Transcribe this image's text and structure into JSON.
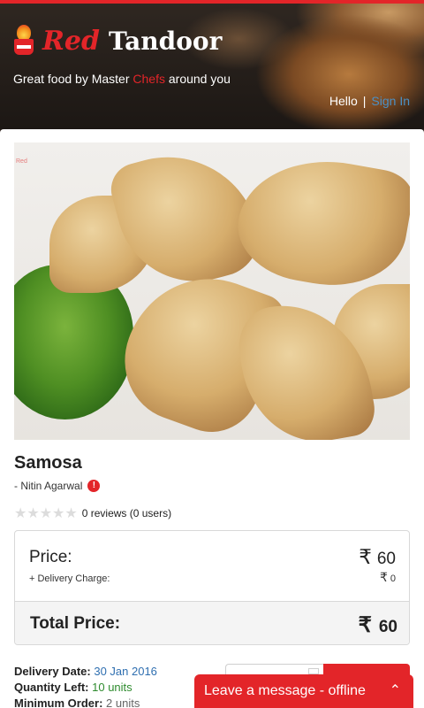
{
  "brand": {
    "name_part1": "Red",
    "name_part2": "Tandoor"
  },
  "tagline": {
    "before": "Great food by Master ",
    "highlight": "Chefs",
    "after": " around you"
  },
  "auth": {
    "greeting": "Hello",
    "separator": "|",
    "signin_label": "Sign In"
  },
  "photo": {
    "watermark": "Red"
  },
  "item": {
    "title": "Samosa",
    "author": "- Nitin Agarwal",
    "rating": {
      "stars": "★★★★★",
      "reviews_text": "0 reviews (0 users)"
    }
  },
  "pricing": {
    "currency_symbol": "₹",
    "price_label": "Price:",
    "price_value": "60",
    "delivery_label": "+ Delivery Charge:",
    "delivery_value": "0",
    "total_label": "Total Price:",
    "total_value": "60"
  },
  "details": {
    "delivery_date_label": "Delivery Date:",
    "delivery_date_value": "30 Jan 2016",
    "quantity_left_label": "Quantity Left:",
    "quantity_left_value": "10 units",
    "minimum_order_label": "Minimum Order:",
    "minimum_order_value": "2 units"
  },
  "chat": {
    "label": "Leave a message - offline",
    "chevron": "⌃"
  },
  "colors": {
    "accent": "#e32529",
    "link": "#4a90c6",
    "date": "#2f6fb0",
    "quantity": "#2e8b2e"
  }
}
